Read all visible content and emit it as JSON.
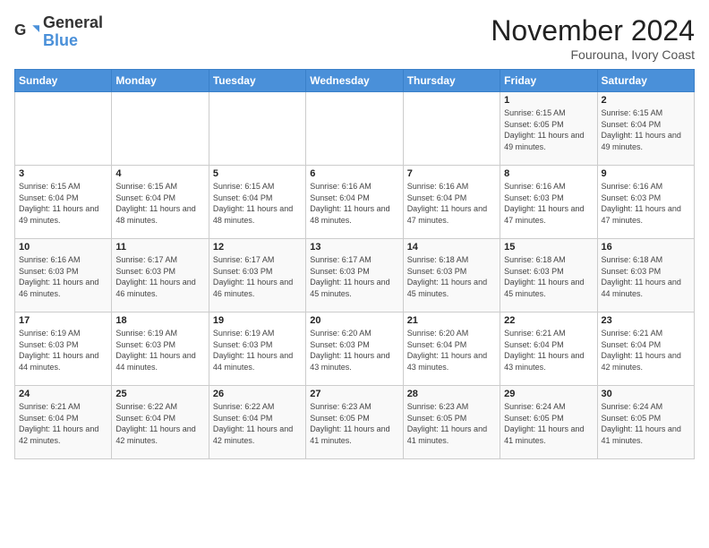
{
  "logo": {
    "general": "General",
    "blue": "Blue"
  },
  "title": "November 2024",
  "location": "Fourouna, Ivory Coast",
  "days_of_week": [
    "Sunday",
    "Monday",
    "Tuesday",
    "Wednesday",
    "Thursday",
    "Friday",
    "Saturday"
  ],
  "weeks": [
    [
      {
        "day": "",
        "info": ""
      },
      {
        "day": "",
        "info": ""
      },
      {
        "day": "",
        "info": ""
      },
      {
        "day": "",
        "info": ""
      },
      {
        "day": "",
        "info": ""
      },
      {
        "day": "1",
        "info": "Sunrise: 6:15 AM\nSunset: 6:05 PM\nDaylight: 11 hours and 49 minutes."
      },
      {
        "day": "2",
        "info": "Sunrise: 6:15 AM\nSunset: 6:04 PM\nDaylight: 11 hours and 49 minutes."
      }
    ],
    [
      {
        "day": "3",
        "info": "Sunrise: 6:15 AM\nSunset: 6:04 PM\nDaylight: 11 hours and 49 minutes."
      },
      {
        "day": "4",
        "info": "Sunrise: 6:15 AM\nSunset: 6:04 PM\nDaylight: 11 hours and 48 minutes."
      },
      {
        "day": "5",
        "info": "Sunrise: 6:15 AM\nSunset: 6:04 PM\nDaylight: 11 hours and 48 minutes."
      },
      {
        "day": "6",
        "info": "Sunrise: 6:16 AM\nSunset: 6:04 PM\nDaylight: 11 hours and 48 minutes."
      },
      {
        "day": "7",
        "info": "Sunrise: 6:16 AM\nSunset: 6:04 PM\nDaylight: 11 hours and 47 minutes."
      },
      {
        "day": "8",
        "info": "Sunrise: 6:16 AM\nSunset: 6:03 PM\nDaylight: 11 hours and 47 minutes."
      },
      {
        "day": "9",
        "info": "Sunrise: 6:16 AM\nSunset: 6:03 PM\nDaylight: 11 hours and 47 minutes."
      }
    ],
    [
      {
        "day": "10",
        "info": "Sunrise: 6:16 AM\nSunset: 6:03 PM\nDaylight: 11 hours and 46 minutes."
      },
      {
        "day": "11",
        "info": "Sunrise: 6:17 AM\nSunset: 6:03 PM\nDaylight: 11 hours and 46 minutes."
      },
      {
        "day": "12",
        "info": "Sunrise: 6:17 AM\nSunset: 6:03 PM\nDaylight: 11 hours and 46 minutes."
      },
      {
        "day": "13",
        "info": "Sunrise: 6:17 AM\nSunset: 6:03 PM\nDaylight: 11 hours and 45 minutes."
      },
      {
        "day": "14",
        "info": "Sunrise: 6:18 AM\nSunset: 6:03 PM\nDaylight: 11 hours and 45 minutes."
      },
      {
        "day": "15",
        "info": "Sunrise: 6:18 AM\nSunset: 6:03 PM\nDaylight: 11 hours and 45 minutes."
      },
      {
        "day": "16",
        "info": "Sunrise: 6:18 AM\nSunset: 6:03 PM\nDaylight: 11 hours and 44 minutes."
      }
    ],
    [
      {
        "day": "17",
        "info": "Sunrise: 6:19 AM\nSunset: 6:03 PM\nDaylight: 11 hours and 44 minutes."
      },
      {
        "day": "18",
        "info": "Sunrise: 6:19 AM\nSunset: 6:03 PM\nDaylight: 11 hours and 44 minutes."
      },
      {
        "day": "19",
        "info": "Sunrise: 6:19 AM\nSunset: 6:03 PM\nDaylight: 11 hours and 44 minutes."
      },
      {
        "day": "20",
        "info": "Sunrise: 6:20 AM\nSunset: 6:03 PM\nDaylight: 11 hours and 43 minutes."
      },
      {
        "day": "21",
        "info": "Sunrise: 6:20 AM\nSunset: 6:04 PM\nDaylight: 11 hours and 43 minutes."
      },
      {
        "day": "22",
        "info": "Sunrise: 6:21 AM\nSunset: 6:04 PM\nDaylight: 11 hours and 43 minutes."
      },
      {
        "day": "23",
        "info": "Sunrise: 6:21 AM\nSunset: 6:04 PM\nDaylight: 11 hours and 42 minutes."
      }
    ],
    [
      {
        "day": "24",
        "info": "Sunrise: 6:21 AM\nSunset: 6:04 PM\nDaylight: 11 hours and 42 minutes."
      },
      {
        "day": "25",
        "info": "Sunrise: 6:22 AM\nSunset: 6:04 PM\nDaylight: 11 hours and 42 minutes."
      },
      {
        "day": "26",
        "info": "Sunrise: 6:22 AM\nSunset: 6:04 PM\nDaylight: 11 hours and 42 minutes."
      },
      {
        "day": "27",
        "info": "Sunrise: 6:23 AM\nSunset: 6:05 PM\nDaylight: 11 hours and 41 minutes."
      },
      {
        "day": "28",
        "info": "Sunrise: 6:23 AM\nSunset: 6:05 PM\nDaylight: 11 hours and 41 minutes."
      },
      {
        "day": "29",
        "info": "Sunrise: 6:24 AM\nSunset: 6:05 PM\nDaylight: 11 hours and 41 minutes."
      },
      {
        "day": "30",
        "info": "Sunrise: 6:24 AM\nSunset: 6:05 PM\nDaylight: 11 hours and 41 minutes."
      }
    ]
  ]
}
